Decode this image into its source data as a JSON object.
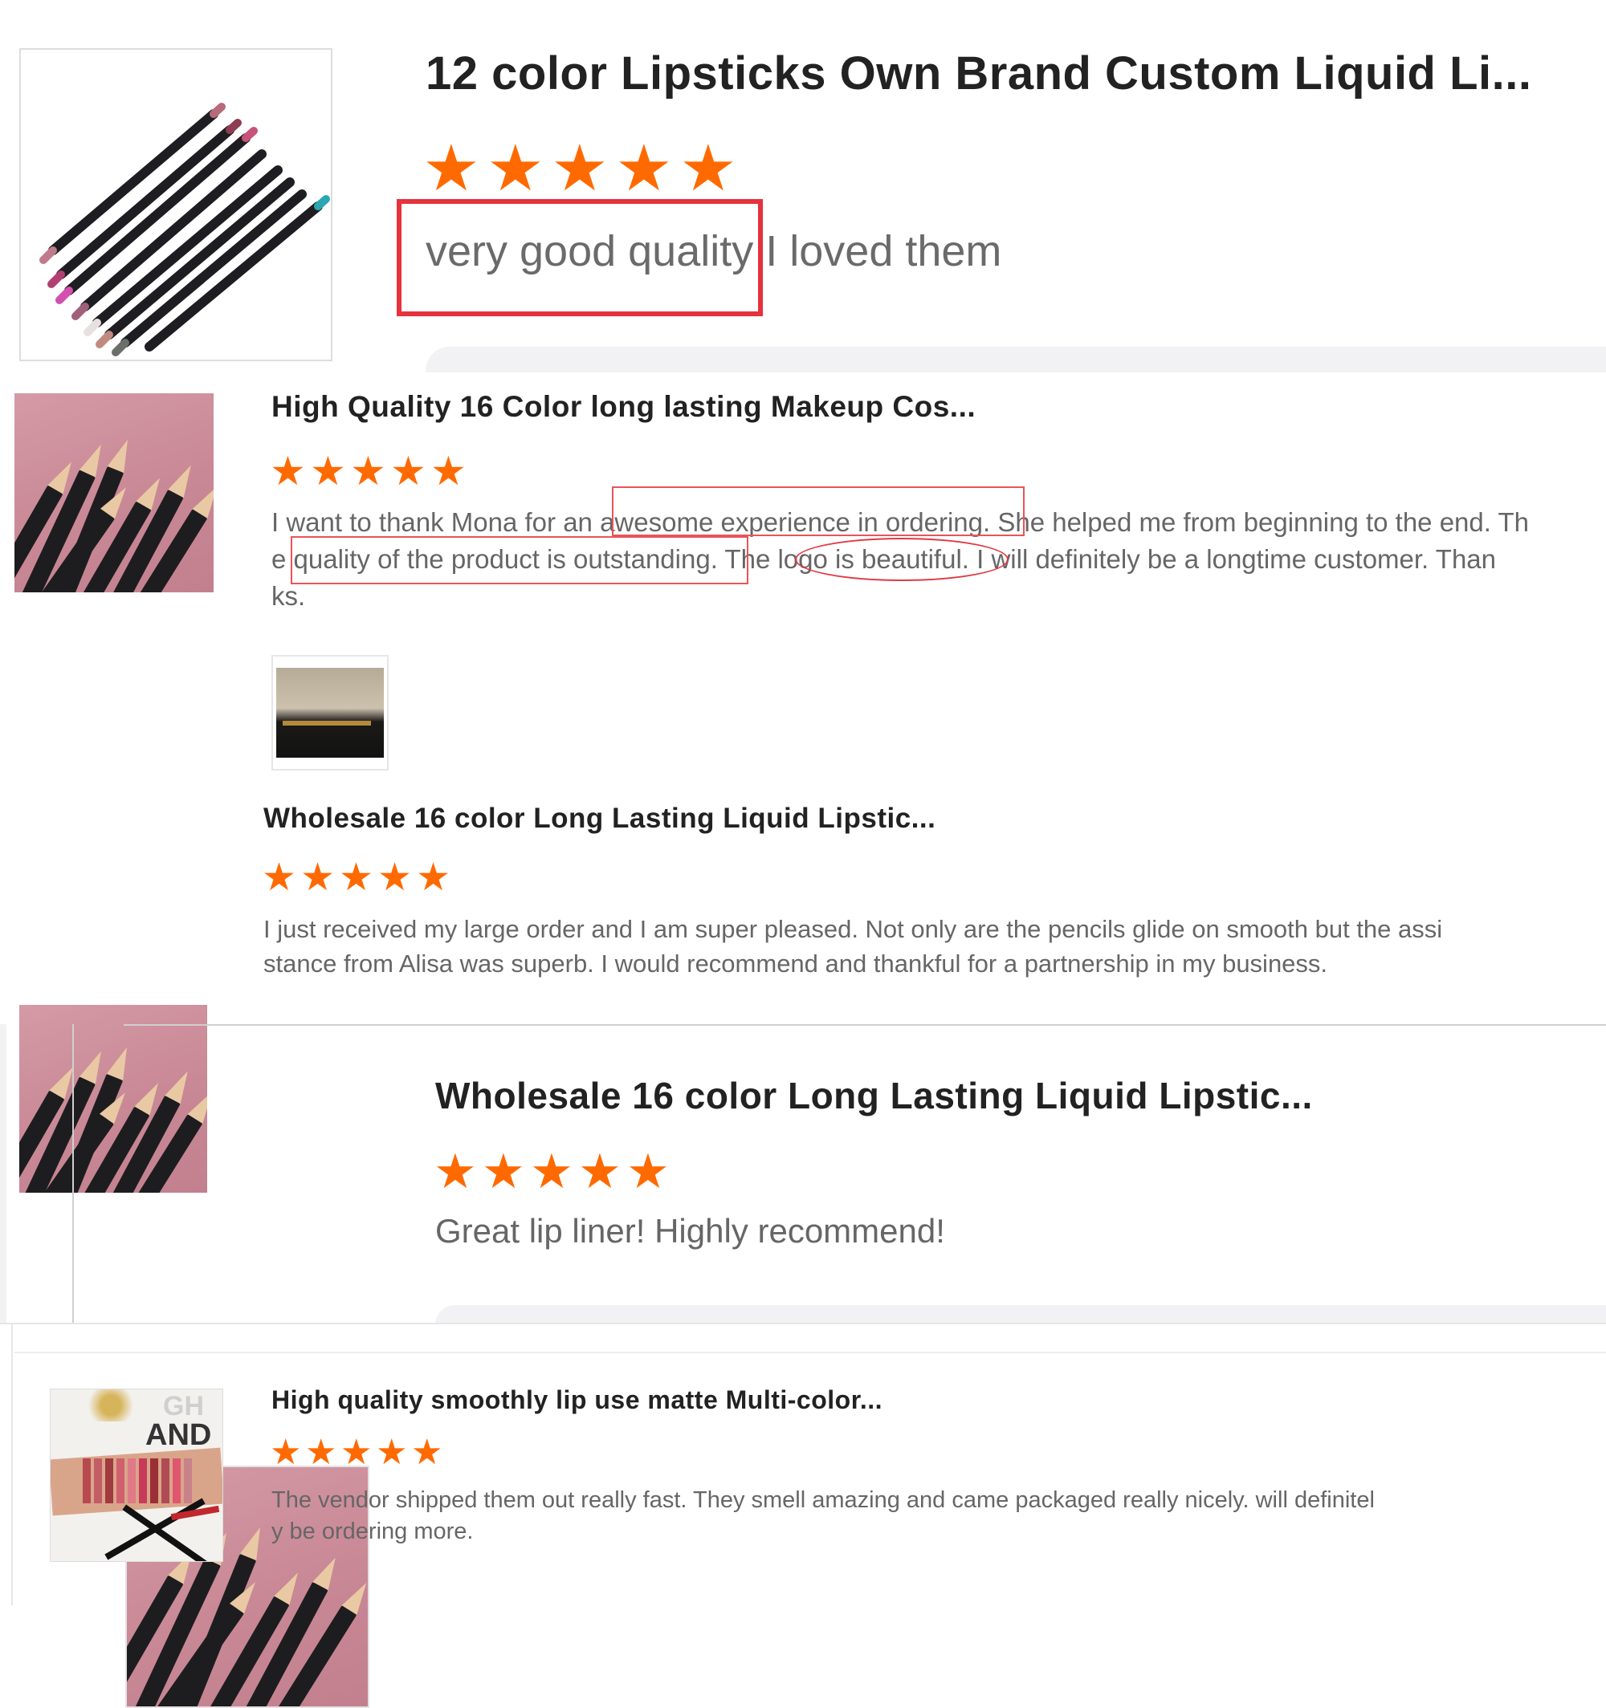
{
  "colors": {
    "star": "#ff6a00",
    "highlight": "#e8545a",
    "title": "#222222",
    "body": "#666666"
  },
  "reviews": [
    {
      "title": "12 color Lipsticks Own Brand Custom Liquid Li...",
      "rating": 5,
      "text": "very good quality I loved them",
      "highlight_phrase": "very good quality",
      "image_icon": "pencil-set-image"
    },
    {
      "title": "High Quality 16 Color long lasting Makeup Cos...",
      "rating": 5,
      "text_lines": [
        "I want to thank Mona for an awesome experience in ordering. She helped me from beginning to the end. Th",
        "e quality of the product is outstanding. The logo is beautiful. I will definitely be a longtime customer. Than",
        "ks."
      ],
      "highlights": [
        "awesome experience in ordering.",
        "quality of the product is outstanding.",
        "logo is beautiful"
      ],
      "attachment_icon": "logo-photo-thumbnail",
      "image_icon": "pink-pencils-image"
    },
    {
      "title": "Wholesale 16 color Long Lasting Liquid Lipstic...",
      "rating": 5,
      "text_lines": [
        "I just received my large order and I am super pleased. Not only are the pencils glide on smooth but the assi",
        "stance from Alisa was superb. I would recommend and thankful for a partnership in my business."
      ],
      "image_icon": "pink-pencils-image"
    },
    {
      "title": "Wholesale 16 color Long Lasting Liquid Lipstic...",
      "rating": 5,
      "text": "Great lip liner! Highly recommend!",
      "image_icon": "pink-pencils-image"
    },
    {
      "title": "High quality smoothly lip use matte Multi-color...",
      "rating": 5,
      "text_lines": [
        "The vendor shipped them out really fast. They smell amazing and came packaged really nicely. will definitel",
        "y be ordering more."
      ],
      "image_text": "AND",
      "image_text_partial": "GH",
      "image_icon": "swatch-arm-image"
    }
  ]
}
